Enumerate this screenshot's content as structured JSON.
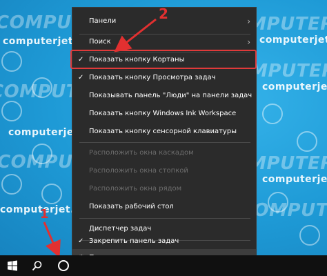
{
  "watermark": {
    "brand": "COMPUTERJET",
    "site": "computerjet.ru"
  },
  "menu": {
    "items": [
      {
        "label": "Панели",
        "submenu": true
      },
      {
        "label": "Поиск",
        "submenu": true
      },
      {
        "label": "Показать кнопку Кортаны",
        "checked": true
      },
      {
        "label": "Показать кнопку Просмотра задач",
        "checked": true
      },
      {
        "label": "Показывать панель \"Люди\" на панели задач"
      },
      {
        "label": "Показать кнопку Windows Ink Workspace"
      },
      {
        "label": "Показать кнопку сенсорной клавиатуры"
      },
      {
        "label": "Расположить окна каскадом",
        "disabled": true
      },
      {
        "label": "Расположить окна стопкой",
        "disabled": true
      },
      {
        "label": "Расположить окна рядом",
        "disabled": true
      },
      {
        "label": "Показать рабочий стол"
      },
      {
        "label": "Диспетчер задач"
      },
      {
        "label": "Закрепить панель задач",
        "checked": true
      },
      {
        "label": "Параметры панели задач",
        "icon": "gear-icon"
      }
    ]
  },
  "annotations": {
    "step1": "1",
    "step2": "2",
    "color": "#e23030"
  },
  "taskbar": {
    "icons": [
      "windows-start-icon",
      "search-icon",
      "cortana-icon"
    ]
  }
}
